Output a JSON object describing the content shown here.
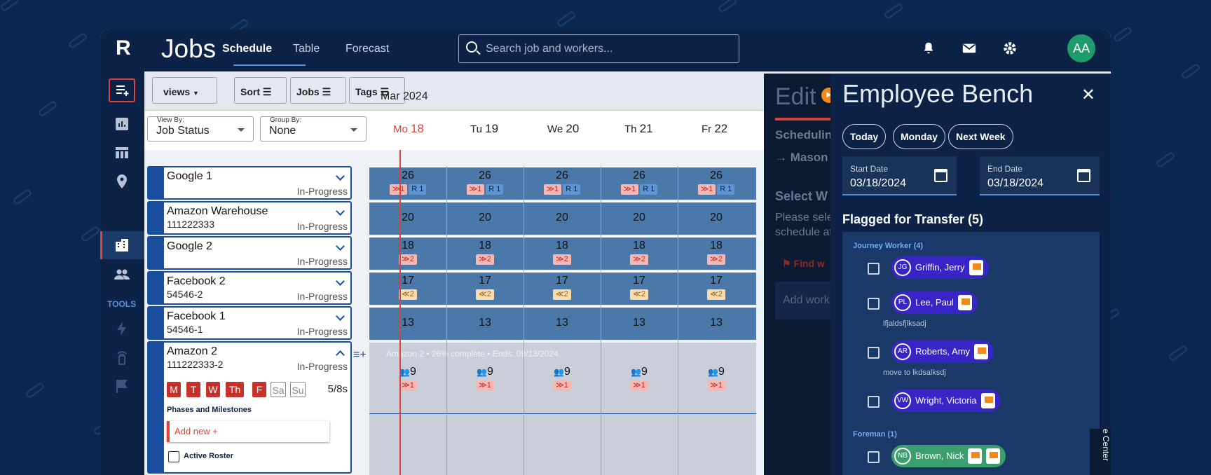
{
  "app": {
    "logo": "R",
    "title": "Jobs",
    "avatar_initials": "AA"
  },
  "tabs": [
    {
      "label": "Schedule",
      "active": true
    },
    {
      "label": "Table",
      "active": false
    },
    {
      "label": "Forecast",
      "active": false
    }
  ],
  "search": {
    "placeholder": "Search job and workers..."
  },
  "sidebar": {
    "tools_label": "TOOLS",
    "icons": [
      "add-job-icon",
      "chart-icon",
      "table-icon",
      "location-icon",
      "building-icon",
      "people-icon",
      "lightning-icon",
      "wifi-icon",
      "flag-icon"
    ]
  },
  "toolbar": {
    "views_label": "views",
    "sort_label": "Sort",
    "jobs_label": "Jobs",
    "tags_label": "Tags"
  },
  "filters": {
    "view_by_label": "View By:",
    "view_by_value": "Job Status",
    "group_by_label": "Group By:",
    "group_by_value": "None"
  },
  "calendar": {
    "month": "Mar 2024",
    "days": [
      {
        "dow": "Mo",
        "num": "18",
        "today": true
      },
      {
        "dow": "Tu",
        "num": "19"
      },
      {
        "dow": "We",
        "num": "20"
      },
      {
        "dow": "Th",
        "num": "21"
      },
      {
        "dow": "Fr",
        "num": "22"
      }
    ]
  },
  "jobs": [
    {
      "name": "Google 1",
      "number": "",
      "status": "In-Progress",
      "count": "26",
      "badges": [
        {
          "t": "≫1",
          "c": "red"
        },
        {
          "t": "R 1",
          "c": "blue"
        }
      ]
    },
    {
      "name": "Amazon Warehouse",
      "number": "111222333",
      "status": "In-Progress",
      "count": "20",
      "badges": []
    },
    {
      "name": "Google 2",
      "number": "",
      "status": "In-Progress",
      "count": "18",
      "badges": [
        {
          "t": "≫2",
          "c": "red"
        }
      ]
    },
    {
      "name": "Facebook 2",
      "number": "54546-2",
      "status": "In-Progress",
      "count": "17",
      "badges": [
        {
          "t": "≪2",
          "c": "amber"
        }
      ]
    },
    {
      "name": "Facebook 1",
      "number": "54546-1",
      "status": "In-Progress",
      "count": "13",
      "badges": []
    },
    {
      "name": "Amazon 2",
      "number": "111222333-2",
      "status": "In-Progress",
      "count": "9",
      "badges": [
        {
          "t": "≫1",
          "c": "red"
        }
      ]
    }
  ],
  "expanded_job": {
    "summary": "Amazon 2 • 26% complete • Ends: 09/13/2024",
    "days": [
      "M",
      "T",
      "W",
      "Th",
      "F",
      "Sa",
      "Su"
    ],
    "shift": "5/8s",
    "phases_label": "Phases and Milestones",
    "add_new": "Add new +",
    "active_roster": "Active Roster"
  },
  "edit_panel": {
    "title": "Edit",
    "sched": "Schedulin",
    "mason": "→ Mason",
    "select": "Select W",
    "please": "Please sele",
    "schedule": "schedule at",
    "find": "Find w",
    "add_work": "Add work"
  },
  "bench": {
    "title": "Employee Bench",
    "quick": [
      "Today",
      "Monday",
      "Next Week"
    ],
    "start_label": "Start Date",
    "start_value": "03/18/2024",
    "end_label": "End Date",
    "end_value": "03/18/2024",
    "flagged_title": "Flagged for Transfer (5)",
    "groups": [
      {
        "name": "Journey Worker (4)",
        "workers": [
          {
            "initials": "JG",
            "name": "Griffin, Jerry",
            "note": ""
          },
          {
            "initials": "PL",
            "name": "Lee, Paul",
            "note": "lfjaldsfjlksadj"
          },
          {
            "initials": "AR",
            "name": "Roberts, Amy",
            "note": "move to lkdsalksdj"
          },
          {
            "initials": "VW",
            "name": "Wright, Victoria",
            "note": ""
          }
        ]
      },
      {
        "name": "Foreman (1)",
        "workers": [
          {
            "initials": "NB",
            "name": "Brown, Nick",
            "note": ""
          }
        ]
      }
    ],
    "resource_center": "e Center"
  },
  "colors": {
    "navy": "#0c2347",
    "accent_red": "#e0433e",
    "job_blue": "#4a78a8",
    "chip_purple": "#3825c5",
    "chip_green": "#3a9e6d",
    "flag_orange": "#f2891d"
  }
}
